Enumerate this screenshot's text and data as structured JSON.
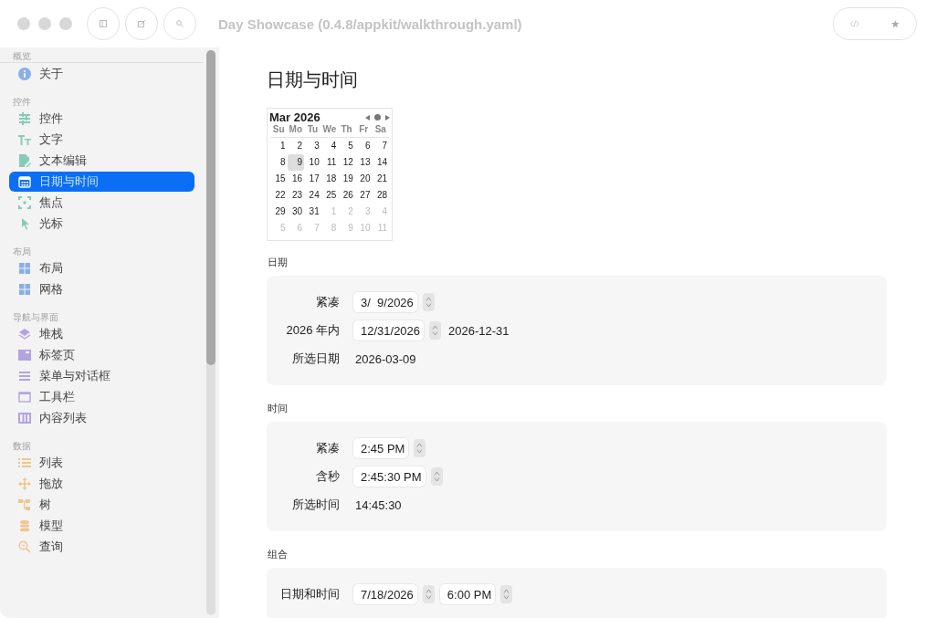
{
  "window": {
    "title": "Day Showcase (0.4.8/appkit/walkthrough.yaml)"
  },
  "sidebar": {
    "groups": [
      {
        "header": "概览",
        "items": [
          {
            "label": "关于",
            "kind": "info",
            "color": "#8aaee8",
            "selected": false
          }
        ]
      },
      {
        "header": "控件",
        "items": [
          {
            "label": "控件",
            "kind": "sliders",
            "color": "#86cbb8",
            "selected": false
          },
          {
            "label": "文字",
            "kind": "text",
            "color": "#86cbb8",
            "selected": false
          },
          {
            "label": "文本编辑",
            "kind": "doc",
            "color": "#86cbb8",
            "selected": false
          },
          {
            "label": "日期与时间",
            "kind": "calendar",
            "selected": true
          },
          {
            "label": "焦点",
            "kind": "focus",
            "color": "#86cbb8",
            "selected": false
          },
          {
            "label": "光标",
            "kind": "pointer",
            "color": "#86cbb8",
            "selected": false
          }
        ]
      },
      {
        "header": "布局",
        "items": [
          {
            "label": "布局",
            "kind": "grid",
            "color": "#8aaee8",
            "selected": false
          },
          {
            "label": "网格",
            "kind": "grid",
            "color": "#8aaee8",
            "selected": false
          }
        ]
      },
      {
        "header": "导航与界面",
        "items": [
          {
            "label": "堆栈",
            "kind": "stack",
            "color": "#b3a3e0",
            "selected": false
          },
          {
            "label": "标签页",
            "kind": "tab",
            "color": "#b3a3e0",
            "selected": false
          },
          {
            "label": "菜单与对话框",
            "kind": "lines",
            "color": "#b3a3e0",
            "selected": false
          },
          {
            "label": "工具栏",
            "kind": "window",
            "color": "#b3a3e0",
            "selected": false
          },
          {
            "label": "内容列表",
            "kind": "columns",
            "color": "#b3a3e0",
            "selected": false
          }
        ]
      },
      {
        "header": "数据",
        "items": [
          {
            "label": "列表",
            "kind": "list",
            "color": "#f0c58e",
            "selected": false
          },
          {
            "label": "拖放",
            "kind": "move",
            "color": "#f0c58e",
            "selected": false
          },
          {
            "label": "树",
            "kind": "tree",
            "color": "#f0c58e",
            "selected": false
          },
          {
            "label": "模型",
            "kind": "db",
            "color": "#f0c58e",
            "selected": false
          },
          {
            "label": "查询",
            "kind": "search",
            "color": "#f0c58e",
            "selected": false
          }
        ]
      }
    ]
  },
  "page": {
    "title": "日期与时间",
    "calendar": {
      "month": "Mar 2026",
      "weekdays": [
        "Su",
        "Mo",
        "Tu",
        "We",
        "Th",
        "Fr",
        "Sa"
      ],
      "weeks": [
        [
          {
            "day": "1",
            "in_month": true,
            "selected": false
          },
          {
            "day": "2",
            "in_month": true,
            "selected": false
          },
          {
            "day": "3",
            "in_month": true,
            "selected": false
          },
          {
            "day": "4",
            "in_month": true,
            "selected": false
          },
          {
            "day": "5",
            "in_month": true,
            "selected": false
          },
          {
            "day": "6",
            "in_month": true,
            "selected": false
          },
          {
            "day": "7",
            "in_month": true,
            "selected": false
          }
        ],
        [
          {
            "day": "8",
            "in_month": true,
            "selected": false
          },
          {
            "day": "9",
            "in_month": true,
            "selected": true
          },
          {
            "day": "10",
            "in_month": true,
            "selected": false
          },
          {
            "day": "11",
            "in_month": true,
            "selected": false
          },
          {
            "day": "12",
            "in_month": true,
            "selected": false
          },
          {
            "day": "13",
            "in_month": true,
            "selected": false
          },
          {
            "day": "14",
            "in_month": true,
            "selected": false
          }
        ],
        [
          {
            "day": "15",
            "in_month": true,
            "selected": false
          },
          {
            "day": "16",
            "in_month": true,
            "selected": false
          },
          {
            "day": "17",
            "in_month": true,
            "selected": false
          },
          {
            "day": "18",
            "in_month": true,
            "selected": false
          },
          {
            "day": "19",
            "in_month": true,
            "selected": false
          },
          {
            "day": "20",
            "in_month": true,
            "selected": false
          },
          {
            "day": "21",
            "in_month": true,
            "selected": false
          }
        ],
        [
          {
            "day": "22",
            "in_month": true,
            "selected": false
          },
          {
            "day": "23",
            "in_month": true,
            "selected": false
          },
          {
            "day": "24",
            "in_month": true,
            "selected": false
          },
          {
            "day": "25",
            "in_month": true,
            "selected": false
          },
          {
            "day": "26",
            "in_month": true,
            "selected": false
          },
          {
            "day": "27",
            "in_month": true,
            "selected": false
          },
          {
            "day": "28",
            "in_month": true,
            "selected": false
          }
        ],
        [
          {
            "day": "29",
            "in_month": true,
            "selected": false
          },
          {
            "day": "30",
            "in_month": true,
            "selected": false
          },
          {
            "day": "31",
            "in_month": true,
            "selected": false
          },
          {
            "day": "1",
            "in_month": false,
            "selected": false
          },
          {
            "day": "2",
            "in_month": false,
            "selected": false
          },
          {
            "day": "3",
            "in_month": false,
            "selected": false
          },
          {
            "day": "4",
            "in_month": false,
            "selected": false
          }
        ],
        [
          {
            "day": "5",
            "in_month": false,
            "selected": false
          },
          {
            "day": "6",
            "in_month": false,
            "selected": false
          },
          {
            "day": "7",
            "in_month": false,
            "selected": false
          },
          {
            "day": "8",
            "in_month": false,
            "selected": false
          },
          {
            "day": "9",
            "in_month": false,
            "selected": false
          },
          {
            "day": "10",
            "in_month": false,
            "selected": false
          },
          {
            "day": "11",
            "in_month": false,
            "selected": false
          }
        ]
      ]
    },
    "sections": [
      {
        "header": "日期",
        "rows": [
          {
            "label": "紧凑",
            "controls": [
              {
                "kind": "field",
                "value": "3/  9/2026"
              },
              {
                "kind": "stepper"
              }
            ]
          },
          {
            "label": "2026 年内",
            "controls": [
              {
                "kind": "field",
                "value": "12/31/2026"
              },
              {
                "kind": "stepper"
              },
              {
                "kind": "text",
                "value": "2026-12-31"
              }
            ]
          },
          {
            "label": "所选日期",
            "controls": [
              {
                "kind": "text",
                "value": "2026-03-09"
              }
            ]
          }
        ]
      },
      {
        "header": "时间",
        "rows": [
          {
            "label": "紧凑",
            "controls": [
              {
                "kind": "field",
                "value": "2:45 PM"
              },
              {
                "kind": "stepper"
              }
            ]
          },
          {
            "label": "含秒",
            "controls": [
              {
                "kind": "field",
                "value": "2:45:30 PM"
              },
              {
                "kind": "stepper"
              }
            ]
          },
          {
            "label": "所选时间",
            "controls": [
              {
                "kind": "text",
                "value": "14:45:30"
              }
            ]
          }
        ]
      },
      {
        "header": "组合",
        "rows": [
          {
            "label": "日期和时间",
            "controls": [
              {
                "kind": "field",
                "value": "7/18/2026"
              },
              {
                "kind": "stepper"
              },
              {
                "kind": "field",
                "value": "6:00 PM"
              },
              {
                "kind": "stepper"
              }
            ]
          }
        ]
      }
    ]
  }
}
